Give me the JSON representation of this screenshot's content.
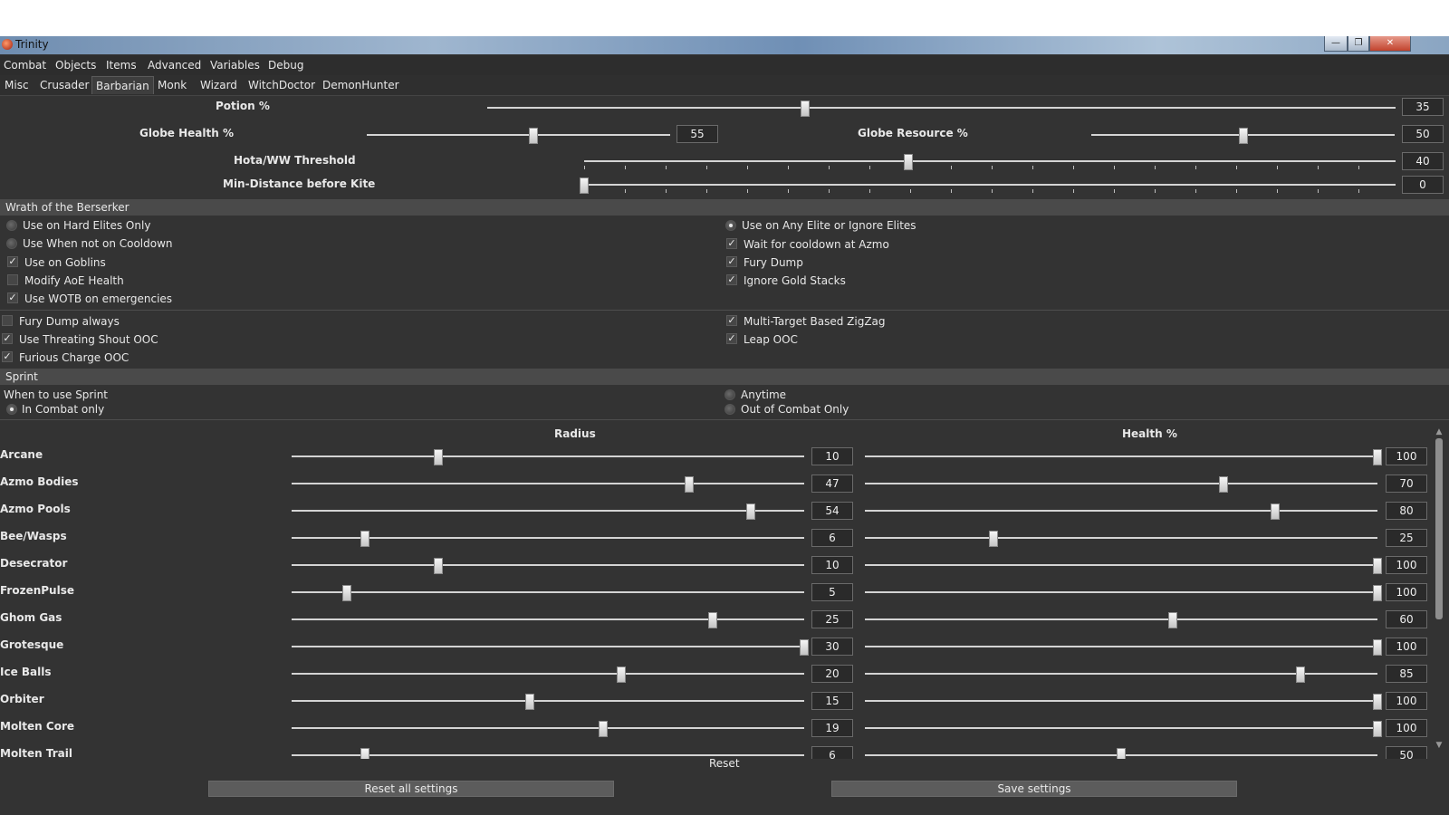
{
  "window": {
    "title": "Trinity"
  },
  "window_buttons": {
    "minimize": "—",
    "maximize": "❐",
    "close": "✕"
  },
  "menu": [
    "Combat",
    "Objects",
    "Items",
    "Advanced",
    "Variables",
    "Debug"
  ],
  "tabs": [
    "Misc",
    "Crusader",
    "Barbarian",
    "Monk",
    "Wizard",
    "WitchDoctor",
    "DemonHunter"
  ],
  "selected_tab": "Barbarian",
  "top_sliders": {
    "potion": {
      "label": "Potion %",
      "value": "35",
      "fraction": 0.35
    },
    "globe_health": {
      "label": "Globe Health %",
      "value": "55",
      "fraction": 0.55
    },
    "globe_resource": {
      "label": "Globe Resource %",
      "value": "50",
      "fraction": 0.5
    },
    "hota_ww": {
      "label": "Hota/WW Threshold",
      "value": "40",
      "fraction": 0.4
    },
    "min_distance": {
      "label": "Min-Distance before Kite",
      "value": "0",
      "fraction": 0.0
    }
  },
  "wotb": {
    "header": "Wrath of the Berserker",
    "left": [
      {
        "label": "Use on Hard Elites Only",
        "type": "radio",
        "checked": false
      },
      {
        "label": "Use When not on Cooldown",
        "type": "radio",
        "checked": false
      },
      {
        "label": "Use on Goblins",
        "type": "check",
        "checked": true
      },
      {
        "label": "Modify AoE Health",
        "type": "check",
        "checked": false
      },
      {
        "label": "Use WOTB on emergencies",
        "type": "check",
        "checked": true
      }
    ],
    "right": [
      {
        "label": "Use on Any Elite or Ignore Elites",
        "type": "radio",
        "checked": true
      },
      {
        "label": "Wait for cooldown at Azmo",
        "type": "check",
        "checked": true
      },
      {
        "label": "Fury Dump",
        "type": "check",
        "checked": true
      },
      {
        "label": "Ignore Gold Stacks",
        "type": "check",
        "checked": true
      }
    ]
  },
  "misc_options": {
    "left": [
      {
        "label": "Fury Dump always",
        "checked": false
      },
      {
        "label": "Use Threating Shout OOC",
        "checked": true
      },
      {
        "label": "Furious Charge OOC",
        "checked": true
      }
    ],
    "right": [
      {
        "label": "Multi-Target Based ZigZag",
        "checked": true
      },
      {
        "label": "Leap OOC",
        "checked": true
      }
    ]
  },
  "sprint": {
    "header": "Sprint",
    "prompt": "When to use Sprint",
    "options": [
      {
        "label": "In Combat only",
        "checked": true
      },
      {
        "label": "Anytime",
        "checked": false
      },
      {
        "label": "Out of Combat Only",
        "checked": false
      }
    ]
  },
  "avoidance": {
    "radius_header": "Radius",
    "health_header": "Health %",
    "radius_max": 30,
    "health_max": 100,
    "rows": [
      {
        "name": "Arcane",
        "radius": 10,
        "health": 100
      },
      {
        "name": "Azmo Bodies",
        "radius": 47,
        "health": 70
      },
      {
        "name": "Azmo Pools",
        "radius": 54,
        "health": 80
      },
      {
        "name": "Bee/Wasps",
        "radius": 6,
        "health": 25
      },
      {
        "name": "Desecrator",
        "radius": 10,
        "health": 100
      },
      {
        "name": "FrozenPulse",
        "radius": 5,
        "health": 100
      },
      {
        "name": "Ghom Gas",
        "radius": 25,
        "health": 60
      },
      {
        "name": "Grotesque",
        "radius": 30,
        "health": 100
      },
      {
        "name": "Ice Balls",
        "radius": 20,
        "health": 85
      },
      {
        "name": "Orbiter",
        "radius": 15,
        "health": 100
      },
      {
        "name": "Molten Core",
        "radius": 19,
        "health": 100
      },
      {
        "name": "Molten Trail",
        "radius": 6,
        "health": 50
      }
    ],
    "radius_fractions": [
      0.286,
      0.776,
      0.896,
      0.143,
      0.286,
      0.107,
      0.821,
      1.0,
      0.643,
      0.464,
      0.607,
      0.143
    ],
    "health_fractions": [
      1.0,
      0.7,
      0.8,
      0.25,
      1.0,
      1.0,
      0.6,
      1.0,
      0.85,
      1.0,
      1.0,
      0.5
    ]
  },
  "footer": {
    "reset": "Reset",
    "reset_all": "Reset all settings",
    "save": "Save settings"
  },
  "scroll": {
    "up": "▲",
    "down": "▼"
  }
}
